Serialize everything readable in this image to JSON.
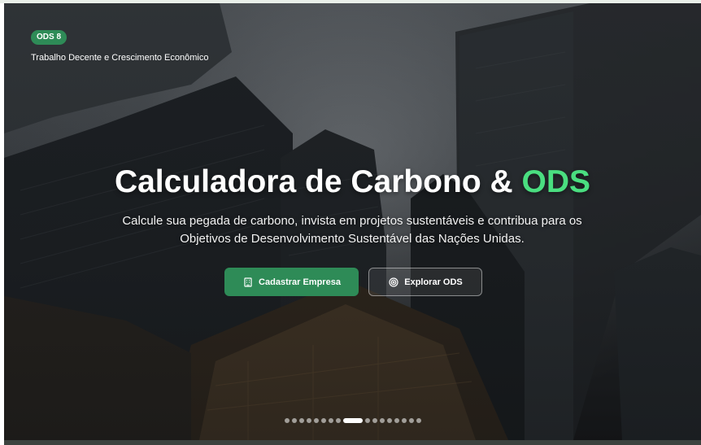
{
  "hero": {
    "badge": "ODS 8",
    "ods_title": "Trabalho Decente e Crescimento Econômico",
    "title_main": "Calculadora de Carbono & ",
    "title_accent": "ODS",
    "description": "Calcule sua pegada de carbono, invista em projetos sustentáveis e contribua para os Objetivos de Desenvolvimento Sustentável das Nações Unidas.",
    "primary_button": {
      "label": "Cadastrar Empresa",
      "icon": "building-icon"
    },
    "secondary_button": {
      "label": "Explorar ODS",
      "icon": "target-icon"
    }
  },
  "carousel": {
    "total_slides": 17,
    "active_index": 8
  },
  "colors": {
    "accent_green": "#4ade80",
    "button_green": "#2e8b57",
    "badge_green": "#2e8b57"
  }
}
